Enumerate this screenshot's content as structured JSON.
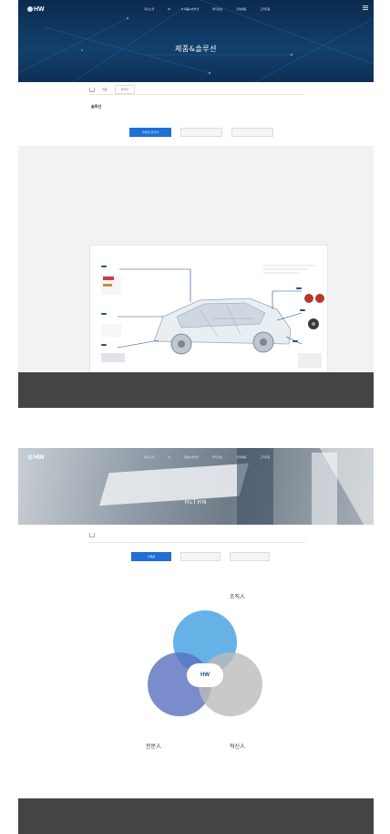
{
  "nav": {
    "logo": "HW",
    "menu": [
      "회사소개",
      "IR",
      "제품&솔루션",
      "투자정보",
      "인재채용",
      "고객지원"
    ]
  },
  "screen1": {
    "hero_title": "제품&솔루션",
    "breadcrumb": [
      "제품",
      "솔루션"
    ],
    "section_title": "솔루션",
    "paragraph": "",
    "buttons": [
      "솔루션 전기차",
      "",
      ""
    ],
    "spec_rows": [
      {
        "k": "",
        "v": ""
      },
      {
        "k": "",
        "v": ""
      },
      {
        "k": "",
        "v": ""
      },
      {
        "k": "",
        "v": ""
      }
    ],
    "diagram_label": "",
    "tags": [
      "",
      "",
      "",
      "",
      "",
      ""
    ],
    "footer": [
      "",
      ""
    ]
  },
  "screen2": {
    "hero_title": "HLTHN",
    "breadcrumb": [
      "",
      ""
    ],
    "buttons": [
      "인재상",
      "",
      ""
    ],
    "venn": {
      "center_logo": "HW",
      "center_sub": "",
      "top": {
        "label": "조직人",
        "sub": "",
        "desc": ""
      },
      "left": {
        "label": "전문人",
        "sub": "",
        "desc": ""
      },
      "right": {
        "label": "혁신人",
        "sub": "",
        "desc": ""
      }
    },
    "footer": [
      "",
      ""
    ]
  },
  "colors": {
    "accent": "#1f6fd6",
    "navy": "#1a4f93",
    "footer": "#444444"
  }
}
